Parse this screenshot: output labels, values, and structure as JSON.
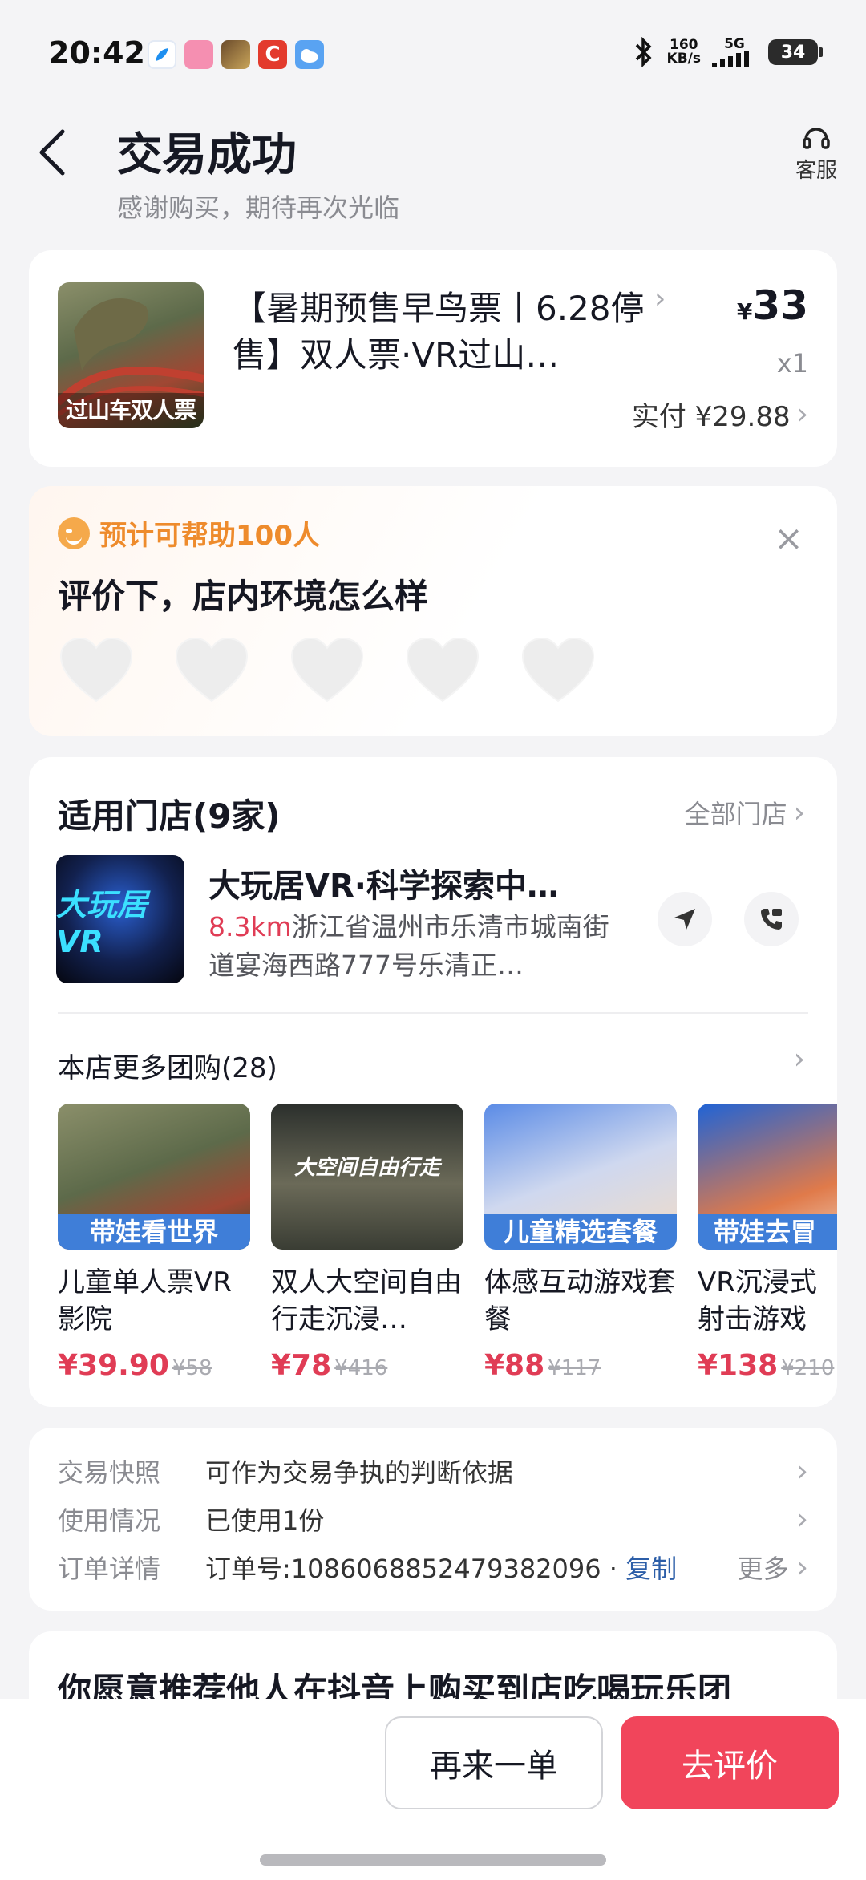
{
  "status_bar": {
    "time": "20:42",
    "net_speed": "160",
    "net_unit": "KB/s",
    "network": "5G",
    "battery": "34"
  },
  "header": {
    "title": "交易成功",
    "subtitle": "感谢购买，期待再次光临",
    "service_label": "客服"
  },
  "product": {
    "image_tag": "过山车双人票",
    "title": "【暑期预售早鸟票丨6.28停售】双人票·VR过山…",
    "price_symbol": "¥",
    "price": "33",
    "qty": "x1",
    "paid": "实付 ¥29.88"
  },
  "review": {
    "help_text": "预计可帮助100人",
    "question": "评价下，店内环境怎么样"
  },
  "stores": {
    "title": "适用门店(9家)",
    "all_link": "全部门店",
    "store_logo_text": "大玩居VR",
    "store_name": "大玩居VR·科学探索中…",
    "distance": "8.3km",
    "address": "浙江省温州市乐清市城南街道宴海西路777号乐清正…",
    "more_title": "本店更多团购(28)",
    "deals": [
      {
        "band": "带娃看世界",
        "name": "儿童单人票VR影院",
        "price": "¥39.90",
        "orig": "¥58"
      },
      {
        "band": "大空间自由行走",
        "name": "双人大空间自由行走沉浸…",
        "price": "¥78",
        "orig": "¥416"
      },
      {
        "band": "儿童精选套餐",
        "name": "体感互动游戏套餐",
        "price": "¥88",
        "orig": "¥117"
      },
      {
        "band": "带娃去冒",
        "name": "VR沉浸式射击游戏",
        "price": "¥138",
        "orig": "¥210"
      }
    ]
  },
  "info": {
    "rows": [
      {
        "label": "交易快照",
        "value": "可作为交易争执的判断依据"
      },
      {
        "label": "使用情况",
        "value": "已使用1份"
      },
      {
        "label": "订单详情",
        "value": "订单号:1086068852479382096 · ",
        "copy": "复制",
        "more": "更多"
      }
    ]
  },
  "recommend": {
    "title": "你愿意推荐他人在抖音上购买到店吃喝玩乐团"
  },
  "bottom": {
    "again_label": "再来一单",
    "review_label": "去评价"
  },
  "colors": {
    "accent_red": "#f1455b",
    "price_red": "#e03c55",
    "help_orange": "#ee8b2c",
    "link_blue": "#2c5ea8"
  }
}
